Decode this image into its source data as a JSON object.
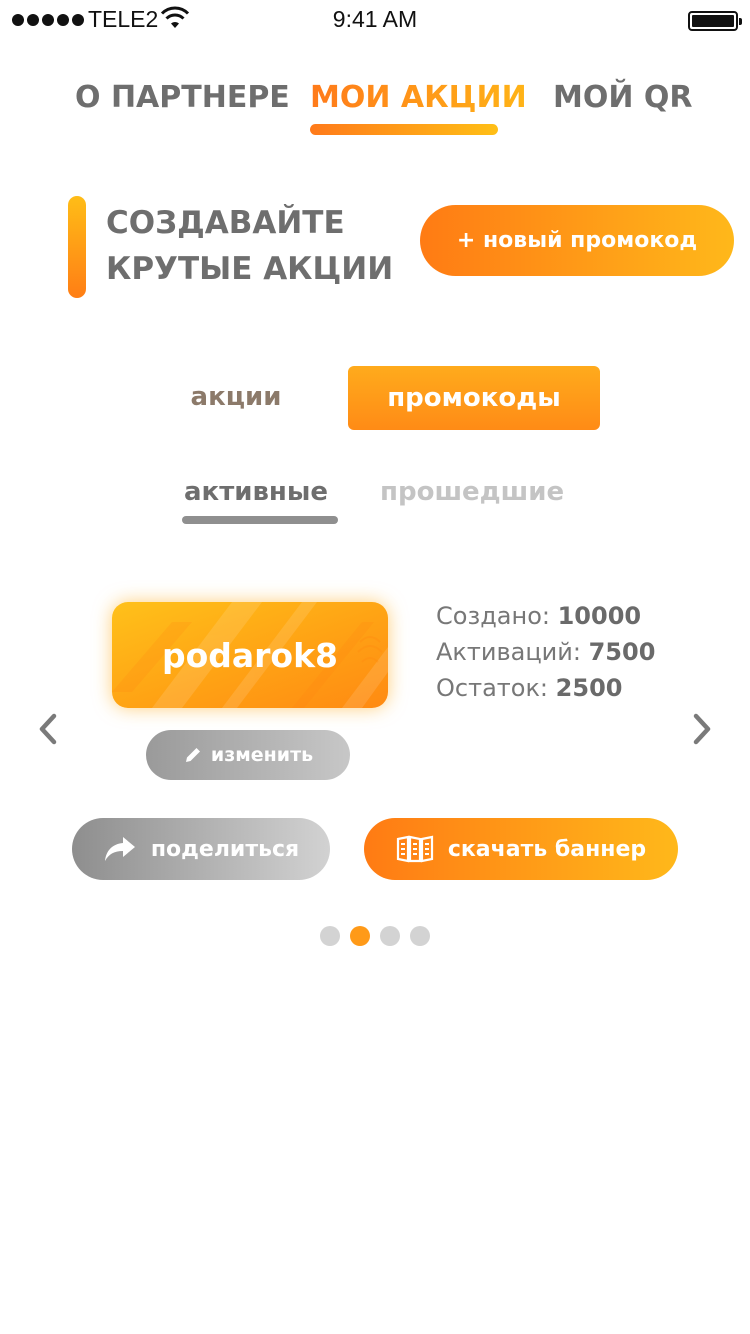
{
  "status_bar": {
    "carrier": "TELE2",
    "time": "9:41 AM"
  },
  "top_tabs": [
    {
      "label": "О ПАРТНЕРЕ",
      "active": false
    },
    {
      "label": "МОИ АКЦИИ",
      "active": true
    },
    {
      "label": "МОЙ QR",
      "active": false
    }
  ],
  "hero": {
    "title_line1": "СОЗДАВАЙТЕ",
    "title_line2": "КРУТЫЕ АКЦИИ",
    "new_button": "+ новый промокод"
  },
  "segment": {
    "actions": "акции",
    "promocodes": "промокоды",
    "selected": "промокоды"
  },
  "sub_tabs": {
    "active": "активные",
    "past": "прошедшие"
  },
  "promo": {
    "code": "podarok8",
    "edit_label": "изменить",
    "created_label": "Создано:",
    "created_value": "10000",
    "activations_label": "Активаций:",
    "activations_value": "7500",
    "remaining_label": "Остаток:",
    "remaining_value": "2500"
  },
  "actions": {
    "share": "поделиться",
    "download_banner": "скачать баннер"
  },
  "pager": {
    "count": 4,
    "current": 2
  },
  "colors": {
    "accent_start": "#ff7b14",
    "accent_end": "#ffb81a",
    "text_gray": "#6e6e6e",
    "inactive_gray": "#c4c4c4"
  },
  "icons": [
    "wifi-icon",
    "battery-icon",
    "chevron-left-icon",
    "chevron-right-icon",
    "pencil-icon",
    "share-arrow-icon",
    "banner-icon"
  ]
}
